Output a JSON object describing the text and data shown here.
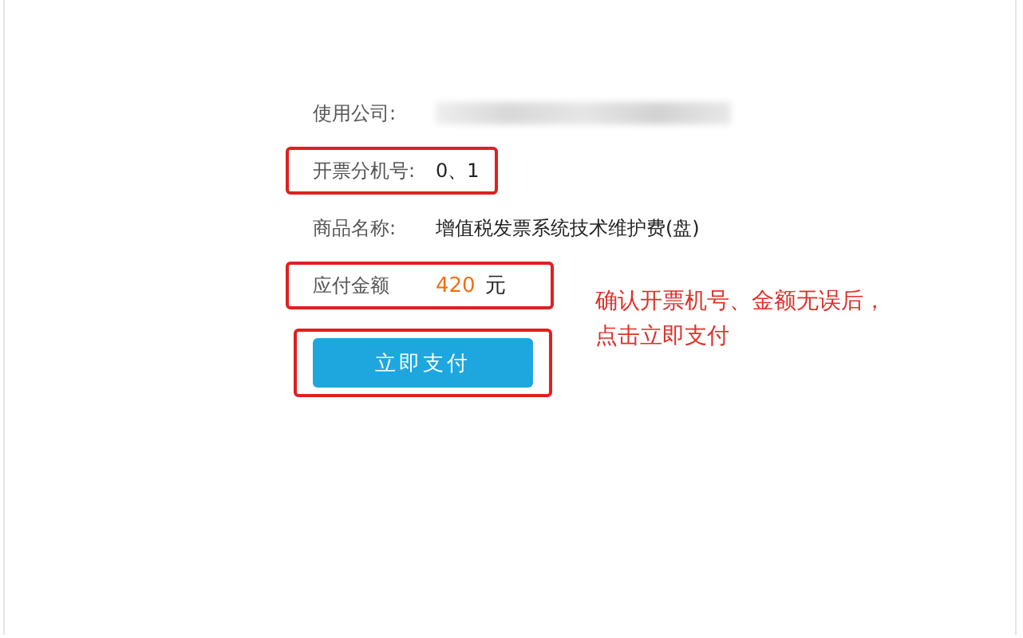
{
  "fields": [
    {
      "label": "使用公司:",
      "value_redacted": true,
      "highlighted": false
    },
    {
      "label": "开票分机号:",
      "value": "0、1",
      "highlighted": true
    },
    {
      "label": "商品名称:",
      "value": "增值税发票系统技术维护费(盘)",
      "highlighted": false
    },
    {
      "label": "应付金额",
      "amount": "420",
      "unit": "元",
      "highlighted": true
    }
  ],
  "pay_button": {
    "label": "立即支付",
    "highlighted": true
  },
  "annotation": [
    "确认开票机号、金额无误后，",
    "点击立即支付"
  ]
}
